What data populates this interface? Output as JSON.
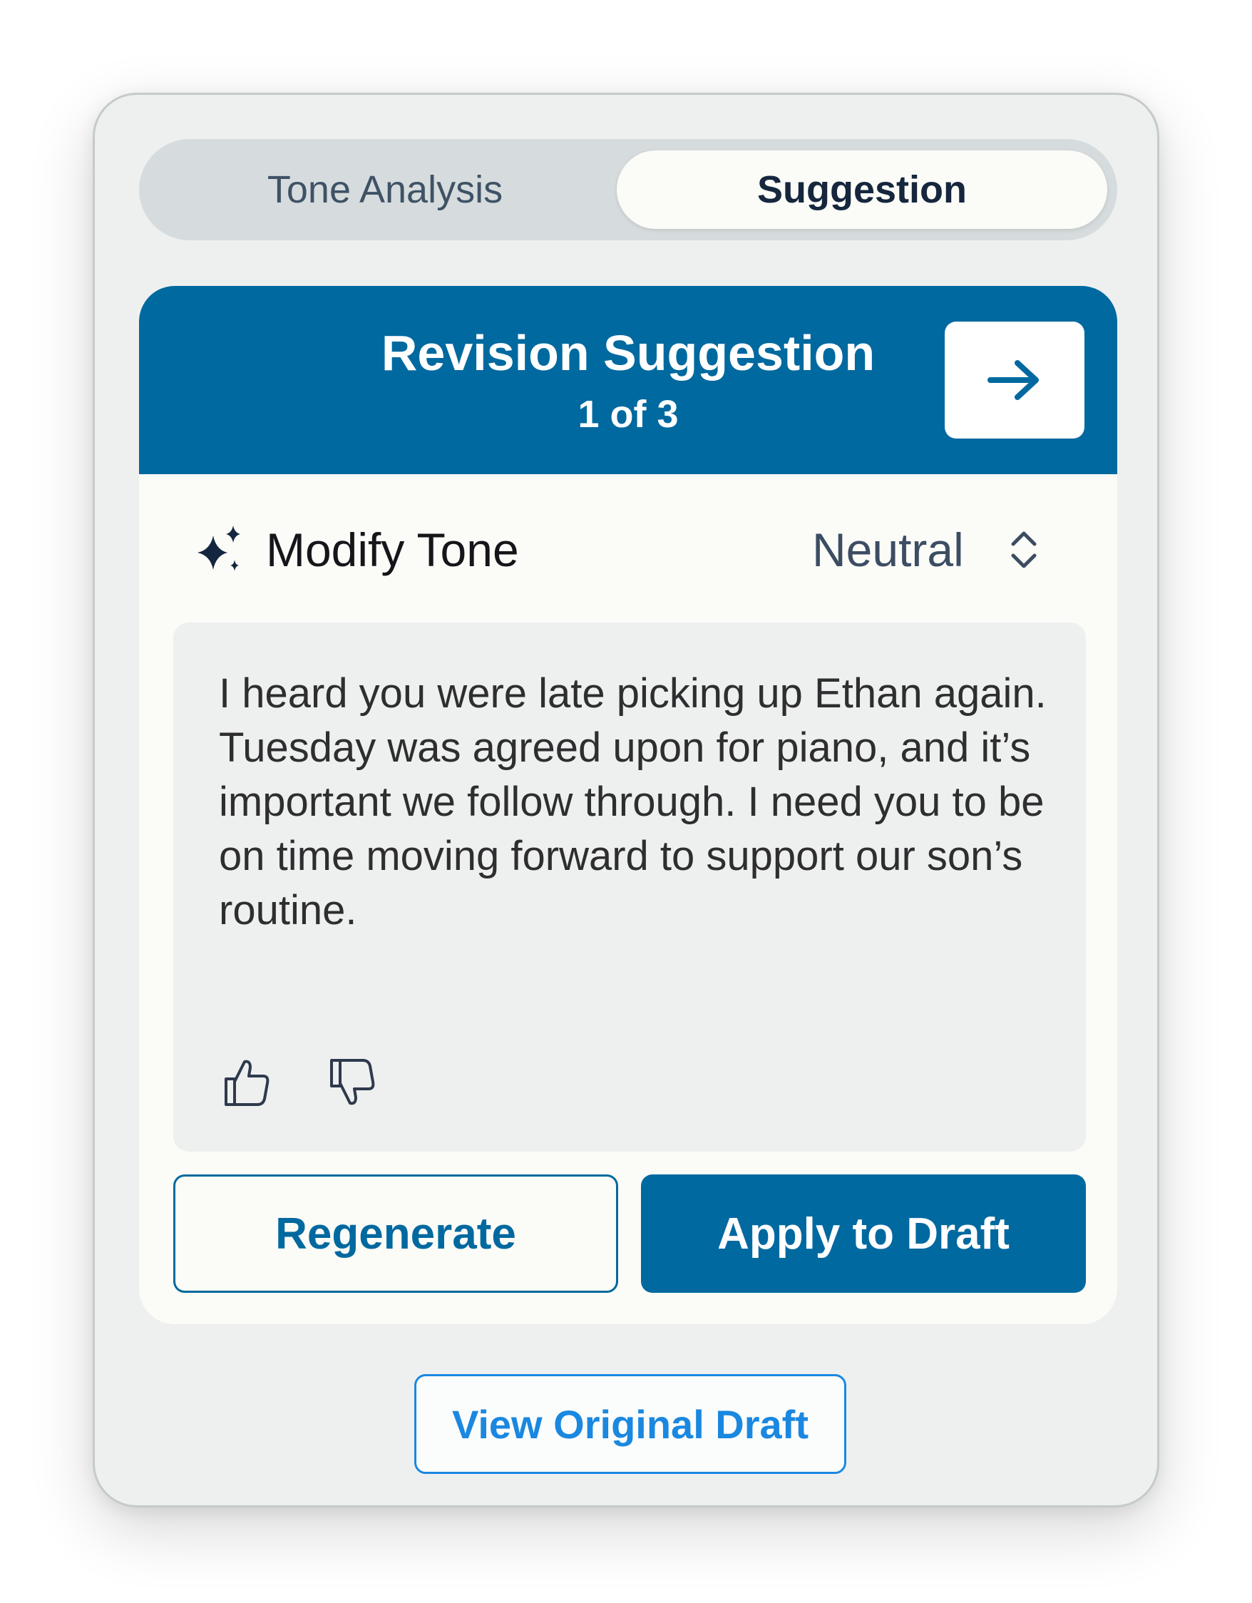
{
  "tabs": {
    "tone_analysis": "Tone Analysis",
    "suggestion": "Suggestion",
    "active": "Suggestion"
  },
  "card": {
    "title": "Revision Suggestion",
    "counter": "1 of 3",
    "next_icon": "arrow-right-icon"
  },
  "tone": {
    "label": "Modify Tone",
    "icon": "sparkle-icon",
    "value": "Neutral",
    "select_icon": "chevron-up-down-icon"
  },
  "suggestion": {
    "text": "I heard you were late picking up Ethan again. Tuesday was agreed upon for piano, and it’s important we follow through. I need you to be on time moving forward to support our son’s routine.",
    "feedback_icons": [
      "thumbs-up-icon",
      "thumbs-down-icon"
    ]
  },
  "actions": {
    "regenerate": "Regenerate",
    "apply": "Apply to Draft"
  },
  "footer": {
    "view_original": "View Original Draft"
  },
  "colors": {
    "primary": "#00699f",
    "link": "#1a88e0",
    "panel_bg": "#eef0f0",
    "card_bg": "#fbfbf7"
  }
}
